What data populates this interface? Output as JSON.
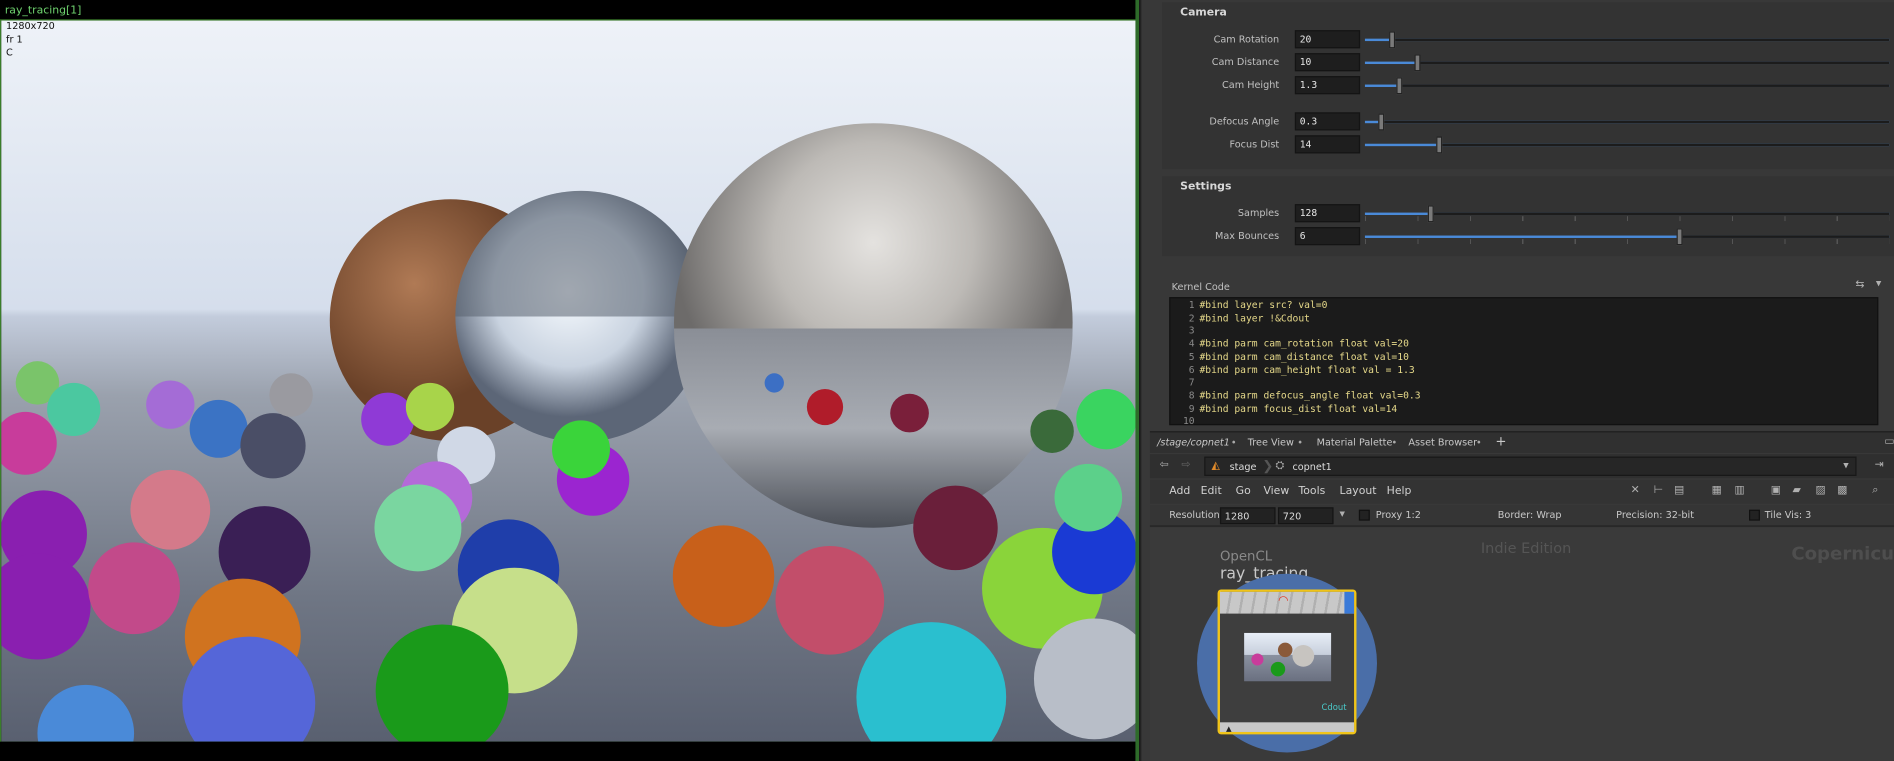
{
  "viewport": {
    "title": "ray_tracing[1]",
    "resolution": "1280x720",
    "frame": "fr 1",
    "channel": "C"
  },
  "camera": {
    "heading": "Camera",
    "params": [
      {
        "label": "Cam Rotation",
        "value": "20",
        "fraction": 0.05
      },
      {
        "label": "Cam Distance",
        "value": "10",
        "fraction": 0.1
      },
      {
        "label": "Cam Height",
        "value": "1.3",
        "fraction": 0.065
      },
      {
        "label": "Defocus Angle",
        "value": "0.3",
        "fraction": 0.03
      },
      {
        "label": "Focus Dist",
        "value": "14",
        "fraction": 0.14
      }
    ]
  },
  "settings": {
    "heading": "Settings",
    "params": [
      {
        "label": "Samples",
        "value": "128",
        "fraction": 0.125
      },
      {
        "label": "Max Bounces",
        "value": "6",
        "fraction": 0.6
      }
    ]
  },
  "kernel": {
    "label": "Kernel Code",
    "lines": [
      {
        "n": "1",
        "code": "#bind layer src? val=0"
      },
      {
        "n": "2",
        "code": "#bind layer !&Cdout"
      },
      {
        "n": "3",
        "code": ""
      },
      {
        "n": "4",
        "code": "#bind parm cam_rotation float val=20"
      },
      {
        "n": "5",
        "code": "#bind parm cam_distance float val=10"
      },
      {
        "n": "6",
        "code": "#bind parm cam_height float val = 1.3"
      },
      {
        "n": "7",
        "code": ""
      },
      {
        "n": "8",
        "code": "#bind parm defocus_angle float val=0.3"
      },
      {
        "n": "9",
        "code": "#bind parm focus_dist float val=14"
      },
      {
        "n": "10",
        "code": ""
      }
    ]
  },
  "tabs": {
    "path": "/stage/copnet1",
    "items": [
      "Tree View",
      "Material Palette",
      "Asset Browser"
    ],
    "add": "+"
  },
  "pathbar": {
    "stage": "stage",
    "net": "copnet1"
  },
  "menus": [
    "Add",
    "Edit",
    "Go",
    "View",
    "Tools",
    "Layout",
    "Help"
  ],
  "options": {
    "resolution_label": "Resolution",
    "res_w": "1280",
    "res_h": "720",
    "proxy": "Proxy 1:2",
    "border": "Border: Wrap",
    "precision": "Precision: 32-bit",
    "tilevis": "Tile Vis: 3"
  },
  "network": {
    "node_type": "OpenCL",
    "node_name": "ray_tracing",
    "watermark": "Indie Edition",
    "context": "Copernicus",
    "output": "Cdout"
  },
  "colors": {
    "accent": "#4a8ad8",
    "node_border": "#f0c419",
    "viewport_title": "#6fd36f"
  }
}
